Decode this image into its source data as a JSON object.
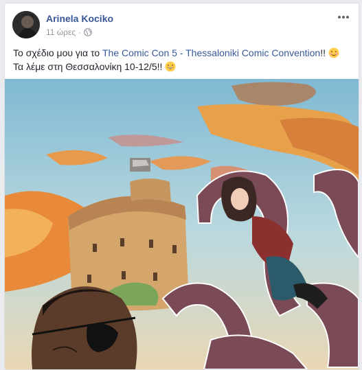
{
  "post": {
    "author": "Arinela Kociko",
    "time": "11 ώρες",
    "separator": "·",
    "privacy_icon": "globe-icon",
    "more_icon": "more-options-icon",
    "line1_prefix": "Το σχέδιο μου για το ",
    "line1_link": "The Comic Con 5 - Thessaloniki Comic Convention",
    "line1_suffix": "!!",
    "line2": "Τα λέμε στη Θεσσαλονίκη 10-12/5!!",
    "emoji1": "smiling-face-icon",
    "emoji2": "grinning-face-icon"
  },
  "image": {
    "description_icon": "illustration-white-tower-thessaloniki-tentacles",
    "colors": {
      "sky": "#9ec9dc",
      "cloud_orange": "#f0a24a",
      "tower": "#d8a86a",
      "tentacle": "#7e4f5c"
    }
  },
  "colors": {
    "link": "#385898",
    "text": "#1d2129",
    "meta": "#90949c"
  }
}
